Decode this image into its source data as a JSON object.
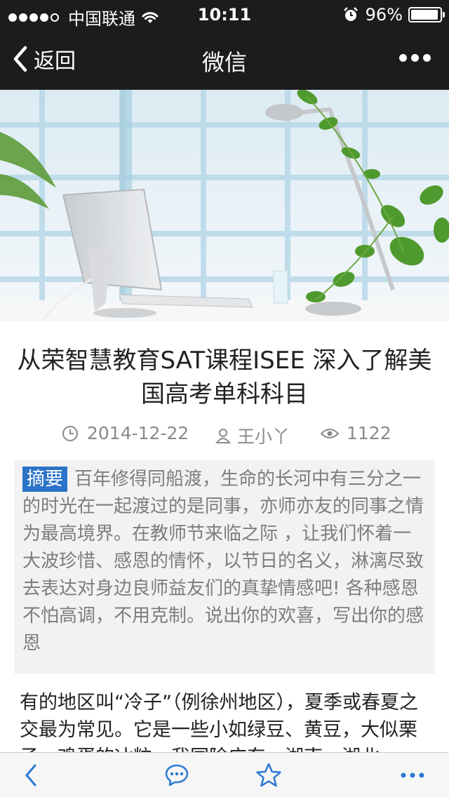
{
  "status_bar": {
    "carrier": "中国联通",
    "time": "10:11",
    "battery": "96%",
    "battery_level": 0.96,
    "signal_bars": 4
  },
  "nav": {
    "back_label": "返回",
    "title": "微信"
  },
  "article": {
    "title": "从荣智慧教育SAT课程ISEE 深入了解美国高考单科科目",
    "date": "2014-12-22",
    "author": "王小丫",
    "views": "1122",
    "abstract_label": "摘要",
    "abstract_text": "百年修得同船渡，生命的长河中有三分之一的时光在一起渡过的是同事，亦师亦友的同事之情为最高境界。在教师节来临之际 ，让我们怀着一大波珍惜、感恩的情怀，以节日的名义，淋漓尽致去表达对身边良师益友们的真挚情感吧! 各种感恩不怕高调，不用克制。说出你的欢喜，写出你的感恩",
    "body_text": "有的地区叫“冷子”（例徐州地区），夏季或春夏之交最为常见。它是一些小如绿豆、黄豆，大似栗子、鸡蛋的冰粒。我国除广东、湖南、湖北"
  },
  "colors": {
    "bar_bg": "#1c1c1f",
    "accent": "#2b73c7",
    "toolbar_icon": "#2a7ad4"
  },
  "icons": {
    "back": "chevron-left-icon",
    "more": "more-dots-icon",
    "clock": "clock-icon",
    "user": "user-icon",
    "eye": "eye-icon",
    "comment": "comment-icon",
    "star": "star-icon"
  }
}
